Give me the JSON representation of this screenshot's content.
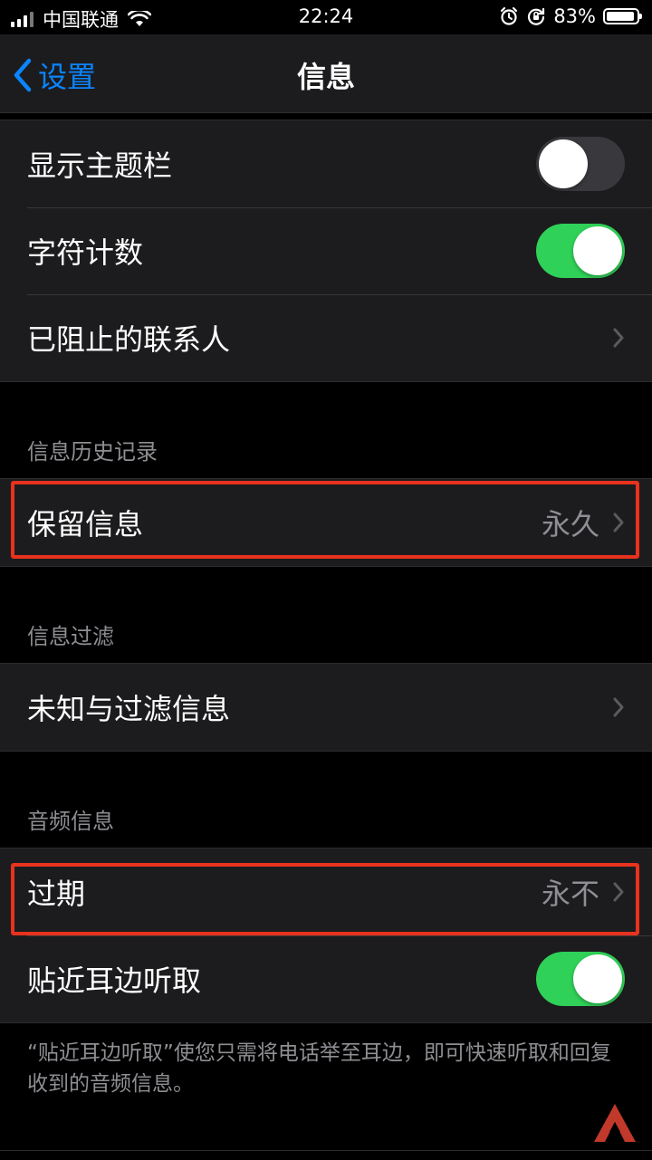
{
  "status_bar": {
    "carrier": "中国联通",
    "time": "22:24",
    "battery_percent": "83%",
    "battery_level": 0.83
  },
  "nav": {
    "back_label": "设置",
    "title": "信息"
  },
  "top_group": [
    {
      "label": "显示主题栏",
      "toggle": "off"
    },
    {
      "label": "字符计数",
      "toggle": "on"
    },
    {
      "label": "已阻止的联系人"
    }
  ],
  "history": {
    "header": "信息历史记录",
    "keep_label": "保留信息",
    "keep_value": "永久"
  },
  "filter": {
    "header": "信息过滤",
    "unknown_label": "未知与过滤信息"
  },
  "audio": {
    "header": "音频信息",
    "expire_label": "过期",
    "expire_value": "永不",
    "raise_label": "贴近耳边听取",
    "footnote": "“贴近耳边听取”使您只需将电话举至耳边，即可快速听取和回复收到的音频信息。"
  },
  "colors": {
    "accent": "#0a84ff",
    "toggle_on": "#30d158",
    "highlight": "#e8321e"
  }
}
